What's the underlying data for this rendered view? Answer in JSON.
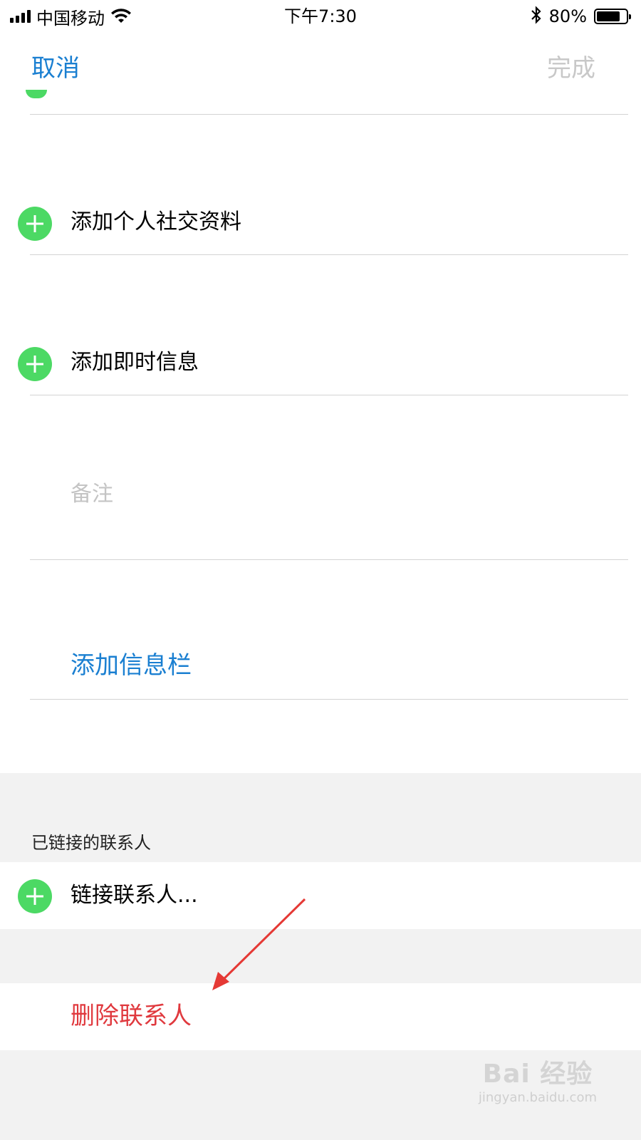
{
  "status_bar": {
    "carrier": "中国移动",
    "time": "下午7:30",
    "battery": "80%",
    "battery_level": 0.8,
    "icons": [
      "signal-icon",
      "wifi-icon",
      "bluetooth-icon",
      "battery-icon"
    ]
  },
  "nav": {
    "cancel_label": "取消",
    "done_label": "完成"
  },
  "rows": {
    "social_profile": "添加个人社交资料",
    "instant_message": "添加即时信息",
    "notes_placeholder": "备注",
    "add_field": "添加信息栏"
  },
  "linked_section": {
    "header": "已链接的联系人",
    "link_contact": "链接联系人..."
  },
  "delete_contact": "删除联系人",
  "watermark": {
    "main": "Bai 经验",
    "sub": "jingyan.baidu.com"
  },
  "colors": {
    "accent_blue": "#1a7fd1",
    "add_green": "#4cd964",
    "delete_red": "#e0393e",
    "annotation_arrow": "#e53935"
  }
}
